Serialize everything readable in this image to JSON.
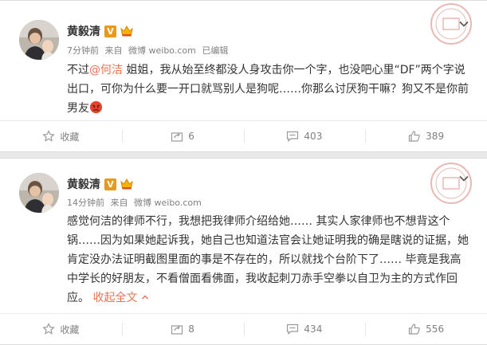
{
  "posts": [
    {
      "author": "黄毅清",
      "verified_badge": "V",
      "time": "7分钟前",
      "source_prefix": "来自",
      "source": "微博 weibo.com",
      "edited": "已编辑",
      "text_pre": "不过",
      "mention": "@何洁",
      "text_post": " 姐姐，我从始至终都没人身攻击你一个字，也没吧心里“DF”两个字说出口，可你为什么要一开口就骂别人是狗呢……你那么讨厌狗干嘛？狗又不是你前男友",
      "actions": {
        "favorite": "收藏",
        "share_count": "6",
        "comment_count": "403",
        "like_count": "389"
      }
    },
    {
      "author": "黄毅清",
      "verified_badge": "V",
      "time": "14分钟前",
      "source_prefix": "来自",
      "source": "微博 weibo.com",
      "text": "感觉何洁的律师不行，我想把我律师介绍给她…… 其实人家律师也不想背这个锅……因为如果她起诉我，她自己也知道法官会让她证明我的确是瞎说的证据，她肯定没办法证明截图里面的事是不存在的，所以就找个台阶下了…… 毕竟是我高中学长的好朋友，不看僧面看佛面，我收起刺刀赤手空拳以自卫为主的方式作回应。",
      "collapse_label": "收起全文",
      "actions": {
        "favorite": "收藏",
        "share_count": "8",
        "comment_count": "434",
        "like_count": "556"
      }
    }
  ],
  "colors": {
    "background": "#e9e9e9",
    "card": "#ffffff",
    "link": "#eb7350",
    "meta": "#808080",
    "verified": "#e99a1b"
  }
}
